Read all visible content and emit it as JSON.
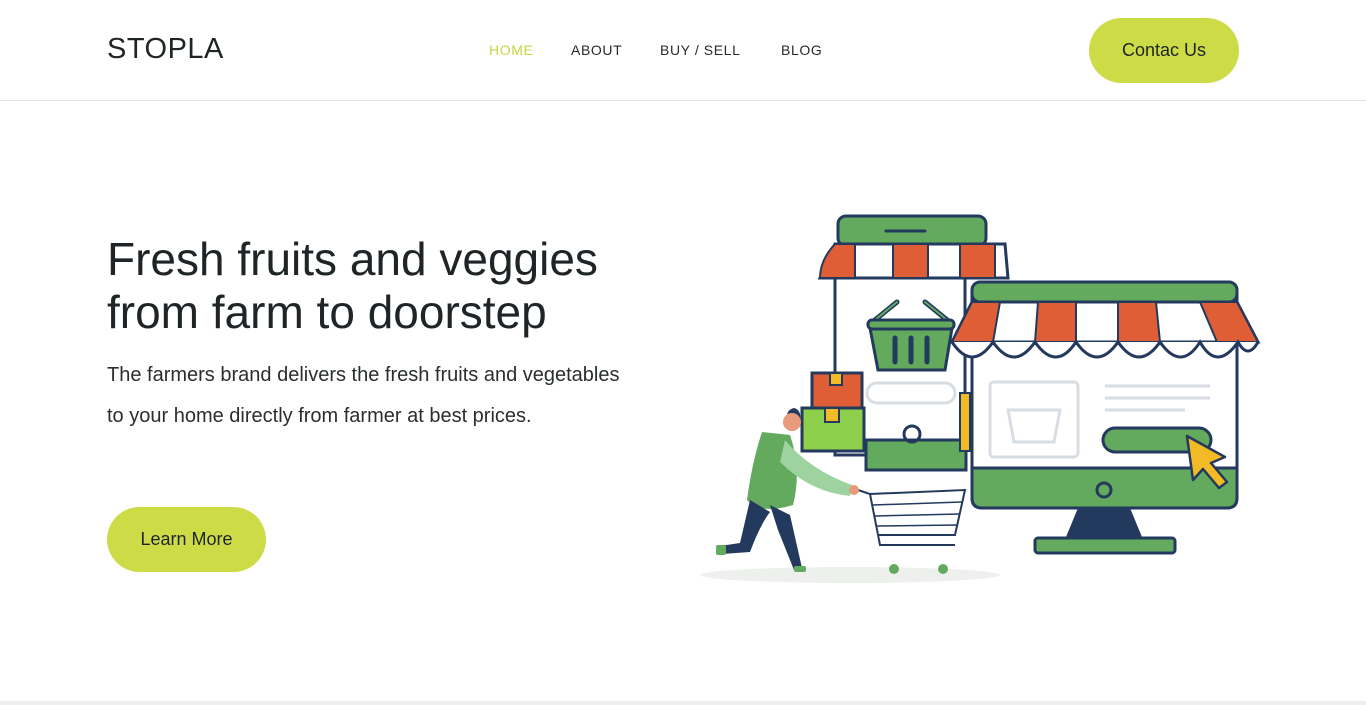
{
  "brand": {
    "logo_text": "STOPLA"
  },
  "nav": {
    "items": [
      {
        "label": "HOME",
        "active": true
      },
      {
        "label": "ABOUT",
        "active": false
      },
      {
        "label": "BUY / SELL",
        "active": false
      },
      {
        "label": "BLOG",
        "active": false
      }
    ],
    "cta_label": "Contac Us"
  },
  "hero": {
    "title": "Fresh fruits and veggies from farm to doorstep",
    "description": "The farmers brand delivers the fresh fruits and vegetables to your home directly from farmer at best prices.",
    "button_label": "Learn More",
    "illustration_icons": [
      "storefront-icon",
      "shopping-basket-icon",
      "monitor-icon",
      "cursor-icon",
      "shopping-cart-icon",
      "person-icon",
      "box-icon"
    ]
  },
  "colors": {
    "accent": "#cddb47",
    "nav_active": "#c7d63f",
    "text": "#1f2426",
    "illustration_green": "#63aa5e",
    "illustration_red": "#e05e36",
    "illustration_navy": "#23395d",
    "illustration_yellow": "#f2bb26"
  }
}
